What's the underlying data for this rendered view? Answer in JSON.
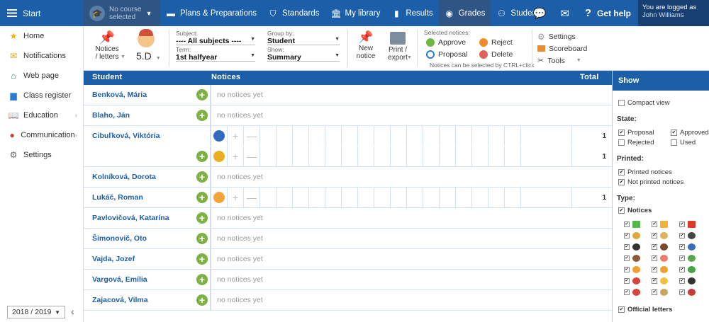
{
  "topbar": {
    "start": "Start",
    "course_l1": "No course",
    "course_l2": "selected",
    "nav": [
      {
        "label": "Plans & Preparations",
        "icon": "plans-icon"
      },
      {
        "label": "Standards",
        "icon": "shield-icon"
      },
      {
        "label": "My library",
        "icon": "library-icon"
      },
      {
        "label": "Results",
        "icon": "bar-chart-icon"
      },
      {
        "label": "Grades",
        "icon": "grades-icon"
      },
      {
        "label": "Students",
        "icon": "students-icon"
      }
    ],
    "help": "Get help",
    "logged_as": "You are logged as",
    "user": "John Williams"
  },
  "sidebar": {
    "items": [
      {
        "label": "Home",
        "icon": "star-icon"
      },
      {
        "label": "Notifications",
        "icon": "envelope-icon"
      },
      {
        "label": "Web page",
        "icon": "home-icon"
      },
      {
        "label": "Class register",
        "icon": "book-icon"
      },
      {
        "label": "Education",
        "icon": "education-icon"
      },
      {
        "label": "Communication",
        "icon": "chat-icon"
      },
      {
        "label": "Settings",
        "icon": "gear-icon"
      }
    ],
    "year": "2018 / 2019"
  },
  "toolbar": {
    "notices_l1": "Notices",
    "notices_l2": "/ letters",
    "class": "5.D",
    "subject_label": "Subject:",
    "subject_value": "---- All subjects ----",
    "term_label": "Term:",
    "term_value": "1st halfyear",
    "group_label": "Group by:",
    "group_value": "Student",
    "show_label": "Show:",
    "show_value": "Summary",
    "new_l1": "New",
    "new_l2": "notice",
    "print_l1": "Print /",
    "print_l2": "export",
    "selected_label": "Selected notices:",
    "approve": "Approve",
    "reject": "Reject",
    "proposal": "Proposal",
    "delete": "Delete",
    "ctrl_hint": "Notices can be selected by CTRL+click",
    "settings": "Settings",
    "scoreboard": "Scoreboard",
    "tools": "Tools"
  },
  "table": {
    "col_student": "Student",
    "col_notices": "Notices",
    "col_total": "Total",
    "empty_text": "no notices yet",
    "rows": [
      {
        "name": "Benková, Mária",
        "notices": []
      },
      {
        "name": "Blaho, Ján",
        "notices": []
      },
      {
        "name": "Cibuľková, Viktória",
        "notices": [
          {
            "icon": "hat-notice-icon",
            "total": "1"
          },
          {
            "icon": "medal-notice-icon",
            "total": "1"
          }
        ]
      },
      {
        "name": "Kolníková, Dorota",
        "notices": []
      },
      {
        "name": "Lukáč, Roman",
        "notices": [
          {
            "icon": "angry-face-notice-icon",
            "total": "1"
          }
        ]
      },
      {
        "name": "Pavlovičová, Katarína",
        "notices": []
      },
      {
        "name": "Šimonovič, Oto",
        "notices": []
      },
      {
        "name": "Vajda, Jozef",
        "notices": []
      },
      {
        "name": "Vargová, Emília",
        "notices": []
      },
      {
        "name": "Zajacová, Vilma",
        "notices": []
      }
    ]
  },
  "show": {
    "title": "Show",
    "compact": "Compact view",
    "state": "State:",
    "proposal": "Proposal",
    "approved": "Approved",
    "rejected": "Rejected",
    "used": "Used",
    "printed": "Printed:",
    "printed_notices": "Printed notices",
    "not_printed": "Not printed notices",
    "type": "Type:",
    "notices": "Notices",
    "official": "Official letters"
  }
}
